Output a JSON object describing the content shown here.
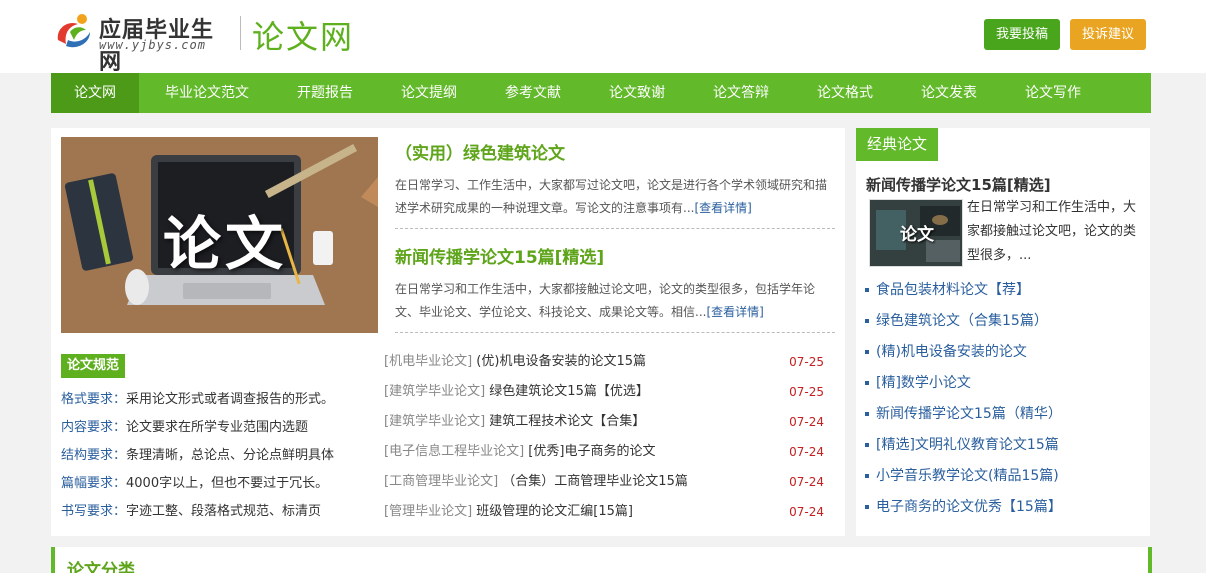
{
  "header": {
    "logo_text": "应届毕业生网",
    "logo_url": "www.yjbys.com",
    "site_title": "论文网",
    "submit_label": "我要投稿",
    "complaint_label": "投诉建议"
  },
  "nav": {
    "items": [
      "论文网",
      "毕业论文范文",
      "开题报告",
      "论文提纲",
      "参考文献",
      "论文致谢",
      "论文答辩",
      "论文格式",
      "论文发表",
      "论文写作"
    ]
  },
  "hero": {
    "image_text": "论文"
  },
  "featured": [
    {
      "title": "（实用）绿色建筑论文",
      "desc": "在日常学习、工作生活中，大家都写过论文吧，论文是进行各个学术领域研究和描述学术研究成果的一种说理文章。写论文的注意事项有...",
      "more": "[查看详情]"
    },
    {
      "title": "新闻传播学论文15篇[精选]",
      "desc": "在日常学习和工作生活中，大家都接触过论文吧，论文的类型很多，包括学年论文、毕业论文、学位论文、科技论文、成果论文等。相信...",
      "more": "[查看详情]"
    }
  ],
  "norms": {
    "label": "论文规范",
    "items": [
      {
        "key": "格式要求：",
        "value": "采用论文形式或者调查报告的形式。"
      },
      {
        "key": "内容要求：",
        "value": "论文要求在所学专业范围内选题"
      },
      {
        "key": "结构要求：",
        "value": "条理清晰，总论点、分论点鲜明具体"
      },
      {
        "key": "篇幅要求：",
        "value": "4000字以上，但也不要过于冗长。"
      },
      {
        "key": "书写要求：",
        "value": "字迹工整、段落格式规范、标清页"
      }
    ]
  },
  "news": [
    {
      "category": "[机电毕业论文]",
      "title": "(优)机电设备安装的论文15篇",
      "date": "07-25"
    },
    {
      "category": "[建筑学毕业论文]",
      "title": "绿色建筑论文15篇【优选】",
      "date": "07-25"
    },
    {
      "category": "[建筑学毕业论文]",
      "title": "建筑工程技术论文【合集】",
      "date": "07-24"
    },
    {
      "category": "[电子信息工程毕业论文]",
      "title": "[优秀]电子商务的论文",
      "date": "07-24"
    },
    {
      "category": "[工商管理毕业论文]",
      "title": "（合集）工商管理毕业论文15篇",
      "date": "07-24"
    },
    {
      "category": "[管理毕业论文]",
      "title": "班级管理的论文汇编[15篇]",
      "date": "07-24"
    }
  ],
  "sidebar": {
    "heading": "经典论文",
    "feature_title": "新闻传播学论文15篇[精选]",
    "thumb_text": "论文",
    "feature_desc": "在日常学习和工作生活中，大家都接触过论文吧，论文的类型很多，...",
    "links": [
      "食品包装材料论文【荐】",
      "绿色建筑论文（合集15篇）",
      "(精)机电设备安装的论文",
      "[精]数学小论文",
      "新闻传播学论文15篇（精华）",
      "[精选]文明礼仪教育论文15篇",
      "小学音乐教学论文(精品15篇)",
      "电子商务的论文优秀【15篇】"
    ]
  },
  "bottom": {
    "title": "论文分类"
  }
}
